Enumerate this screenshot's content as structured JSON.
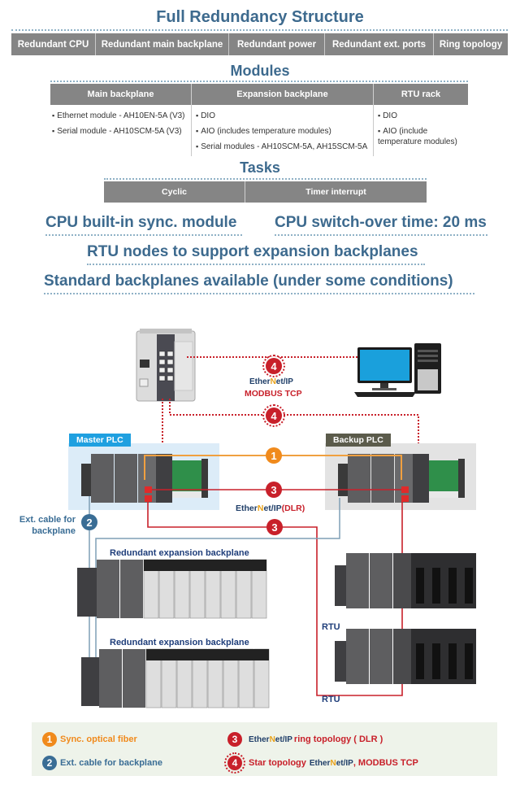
{
  "header": {
    "title": "Full Redundancy Structure",
    "features": [
      "Redundant CPU",
      "Redundant main backplane",
      "Redundant power",
      "Redundant ext. ports",
      "Ring topology"
    ]
  },
  "modules": {
    "title": "Modules",
    "columns": [
      {
        "header": "Main backplane",
        "items": [
          "Ethernet module - AH10EN-5A (V3)",
          "Serial module - AH10SCM-5A (V3)"
        ]
      },
      {
        "header": "Expansion backplane",
        "items": [
          "DIO",
          "AIO (includes temperature modules)",
          "Serial modules - AH10SCM-5A, AH15SCM-5A"
        ]
      },
      {
        "header": "RTU rack",
        "items": [
          "DIO",
          "AIO (include temperature modules)"
        ]
      }
    ]
  },
  "tasks": {
    "title": "Tasks",
    "items": [
      "Cyclic",
      "Timer interrupt"
    ]
  },
  "highlights": {
    "sync_module": "CPU built-in sync. module",
    "switchover": "CPU switch-over time: 20 ms",
    "rtu_nodes": "RTU nodes to support expansion backplanes",
    "standard_backplanes": "Standard backplanes available (under some conditions)"
  },
  "diagram": {
    "master_label": "Master PLC",
    "backup_label": "Backup PLC",
    "ethernetip_prefix": "Ether",
    "ethernetip_n": "N",
    "ethernetip_suffix": "et/IP",
    "modbus_tcp": "MODBUS TCP",
    "dlr": "(DLR)",
    "ext_cable_label_line1": "Ext. cable for",
    "ext_cable_label_line2": "backplane",
    "expansion_label_1": "Redundant expansion backplane",
    "expansion_label_2": "Redundant expansion backplane",
    "rtu_label_1": "RTU",
    "rtu_label_2": "RTU",
    "badges": {
      "sync": "1",
      "ext": "2",
      "ring": "3",
      "star": "4"
    }
  },
  "legend": {
    "items": [
      {
        "num": "1",
        "text": "Sync. optical fiber"
      },
      {
        "num": "2",
        "text": "Ext. cable for backplane"
      },
      {
        "num": "3",
        "text": "ring topology ( DLR )"
      },
      {
        "num": "4",
        "text_pre": "Star topology",
        "text_post": ", MODBUS TCP"
      }
    ]
  },
  "colors": {
    "title_blue": "#3d6a8e",
    "header_gray": "#858585",
    "sync_orange": "#f08a1c",
    "ext_blue": "#3a6d95",
    "ring_red": "#c8202a",
    "master_bg": "#dcecf8",
    "master_label_bg": "#1fa0e0",
    "backup_bg": "#e3e3e3",
    "backup_label_bg": "#5b5b4b",
    "legend_bg": "#eef3ea"
  }
}
